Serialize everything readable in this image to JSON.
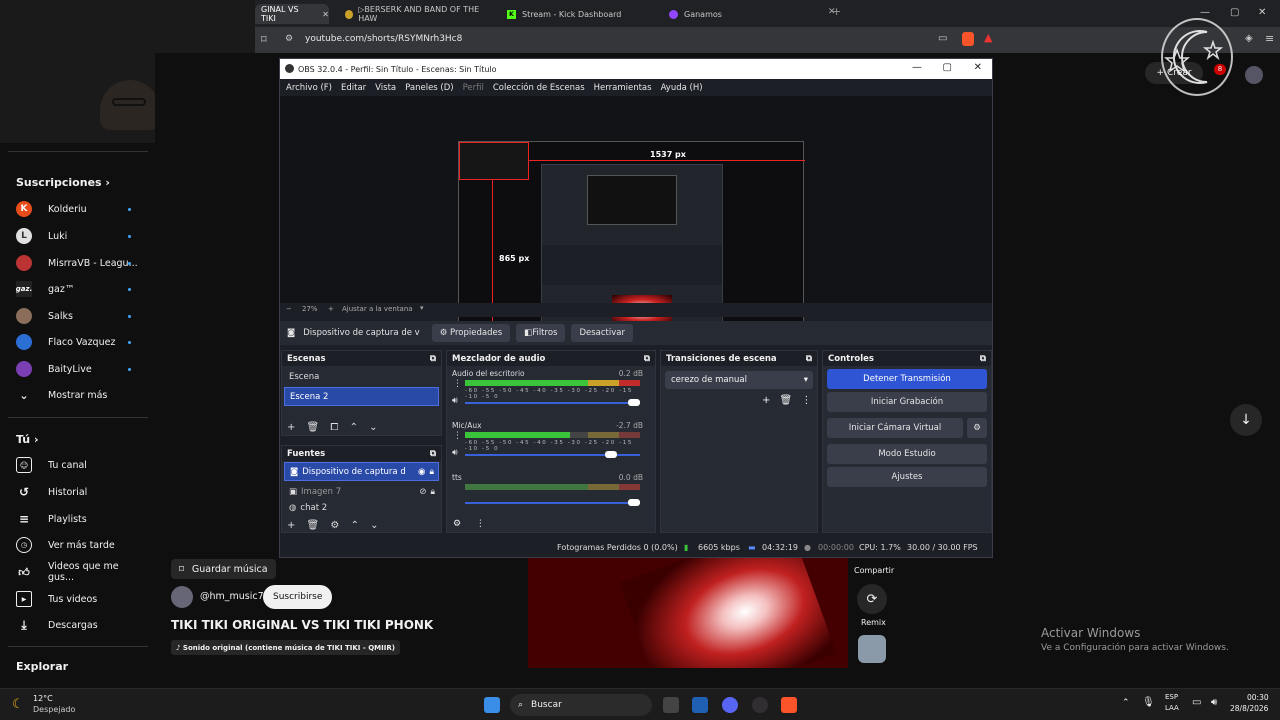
{
  "browser": {
    "tabs": [
      {
        "label": "GINAL VS TIKI",
        "active": true
      },
      {
        "label": "▷BERSERK AND BAND OF THE HAW",
        "active": false
      },
      {
        "label": "Stream - Kick Dashboard",
        "active": false
      },
      {
        "label": "Ganamos",
        "active": false
      }
    ],
    "url": "youtube.com/shorts/RSYMNrh3Hc8"
  },
  "sidebar": {
    "subscriptions_heading": "Suscripciones",
    "subscriptions": [
      {
        "label": "Kolderiu",
        "color": "#e84c1a"
      },
      {
        "label": "Luki",
        "color": "#e0e0e0"
      },
      {
        "label": "MisrraVB - Leagu...",
        "color": "#b33"
      },
      {
        "label": "gaz™",
        "color": "#222"
      },
      {
        "label": "Salks",
        "color": "#8a6d5a"
      },
      {
        "label": "Flaco Vazquez",
        "color": "#2b6fd4"
      },
      {
        "label": "BaityLive",
        "color": "#7b3fb3"
      }
    ],
    "show_more": "Mostrar más",
    "you_heading": "Tú",
    "you_items": [
      {
        "label": "Tu canal",
        "icon": "user-icon"
      },
      {
        "label": "Historial",
        "icon": "history-icon"
      },
      {
        "label": "Playlists",
        "icon": "playlist-icon"
      },
      {
        "label": "Ver más tarde",
        "icon": "clock-icon"
      },
      {
        "label": "Videos que me gus...",
        "icon": "thumb-up-icon"
      },
      {
        "label": "Tus videos",
        "icon": "video-icon"
      },
      {
        "label": "Descargas",
        "icon": "download-icon"
      }
    ],
    "explore_heading": "Explorar"
  },
  "obs": {
    "title": "OBS 32.0.4 - Perfil: Sin Título - Escenas: Sin Título",
    "menu": [
      "Archivo (F)",
      "Editar",
      "Vista",
      "Paneles (D)",
      "Perfil",
      "Colección de Escenas",
      "Herramientas",
      "Ayuda (H)"
    ],
    "preview": {
      "width_label": "1537 px",
      "height_label": "865 px"
    },
    "zoom": {
      "value": "27%",
      "fit_label": "Ajustar a la ventana"
    },
    "source_bar": {
      "source_name": "Dispositivo de captura de v",
      "properties": "Propiedades",
      "filters": "Filtros",
      "deactivate": "Desactivar"
    },
    "scenes": {
      "title": "Escenas",
      "items": [
        "Escena",
        "Escena 2"
      ],
      "selected": 1
    },
    "sources": {
      "title": "Fuentes",
      "items": [
        "Dispositivo de captura d",
        "Imagen 7",
        "chat 2"
      ],
      "selected": 0
    },
    "mixer": {
      "title": "Mezclador de audio",
      "scale": "-60 -55 -50 -45 -40 -35 -30 -25 -20 -15 -10 -5 0",
      "channels": [
        {
          "name": "Audio del escritorio",
          "db": "0.2 dB",
          "level": 0.95,
          "volume": 1.0
        },
        {
          "name": "Mic/Aux",
          "db": "-2.7 dB",
          "level": 0.62,
          "volume": 0.85
        },
        {
          "name": "tts",
          "db": "0.0 dB",
          "level": 0.0,
          "volume": 1.0
        }
      ]
    },
    "transitions": {
      "title": "Transiciones de escena",
      "selected": "cerezo de manual"
    },
    "controls": {
      "title": "Controles",
      "buttons": [
        "Detener Transmisión",
        "Iniciar Grabación",
        "Iniciar Cámara Virtual",
        "Modo Estudio",
        "Ajustes"
      ]
    },
    "status": {
      "dropped": "Fotogramas Perdidos 0 (0.0%)",
      "bitrate": "6605 kbps",
      "stream_time": "04:32:19",
      "rec_time": "00:00:00",
      "cpu": "CPU: 1.7%",
      "fps": "30.00 / 30.00 FPS"
    }
  },
  "short": {
    "save_music": "Guardar música",
    "channel": "@hm_music7",
    "subscribe": "Suscribirse",
    "title": "TIKI TIKI ORIGINAL VS TIKI TIKI PHONK",
    "sound": "♪ Sonido original (contiene música de TIKI TIKI - QMIIR)",
    "share": "Compartir",
    "remix": "Remix",
    "create": "Crear",
    "notif_count": "8"
  },
  "watermark": {
    "line1": "Activar Windows",
    "line2": "Ve a Configuración para activar Windows."
  },
  "taskbar": {
    "weather_temp": "12°C",
    "weather_desc": "Despejado",
    "search": "Buscar",
    "lang1": "ESP",
    "lang2": "LAA",
    "time": "00:30",
    "date": "28/8/2026"
  }
}
